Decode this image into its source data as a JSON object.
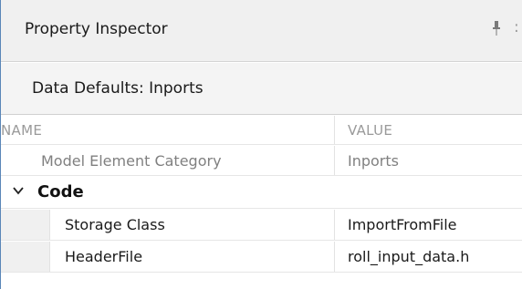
{
  "panel": {
    "title": "Property Inspector",
    "subheader": "Data Defaults: Inports"
  },
  "grid": {
    "columns": {
      "name": "NAME",
      "value": "VALUE"
    },
    "rows": [
      {
        "name": "Model Element Category",
        "value": "Inports"
      }
    ],
    "section": {
      "label": "Code",
      "expanded": true,
      "rows": [
        {
          "name": "Storage Class",
          "value": "ImportFromFile"
        },
        {
          "name": "HeaderFile",
          "value": "roll_input_data.h"
        }
      ]
    }
  },
  "colors": {
    "accent_border": "#5a86b8",
    "title_bg": "#f0f0f0",
    "muted_text": "#808080"
  },
  "icons": {
    "pin": "pin-icon",
    "chevron": "chevron-down-icon"
  }
}
